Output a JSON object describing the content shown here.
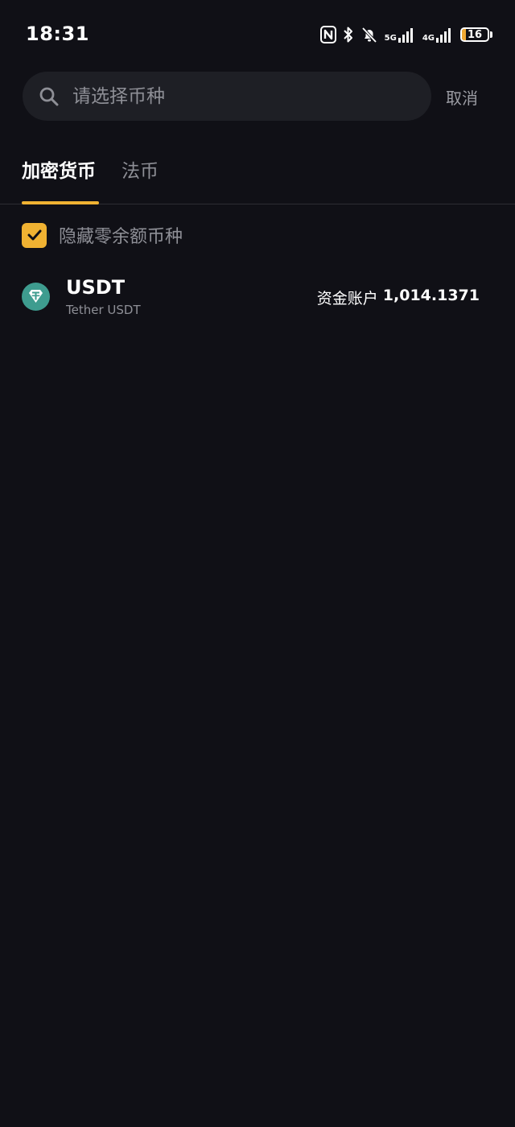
{
  "status_bar": {
    "time": "18:31",
    "network_5g": "5G",
    "network_4g": "4G",
    "battery_level": "16",
    "battery_color": "#f0a832",
    "icons": [
      "nfc-icon",
      "bluetooth-icon",
      "bell-muted-icon",
      "signal-icon",
      "battery-icon"
    ]
  },
  "search": {
    "placeholder": "请选择币种",
    "value": "",
    "cancel_label": "取消"
  },
  "tabs": [
    {
      "label": "加密货币",
      "active": true
    },
    {
      "label": "法币",
      "active": false
    }
  ],
  "filter": {
    "hide_zero_label": "隐藏零余额币种",
    "checked": true
  },
  "assets": [
    {
      "symbol": "USDT",
      "name": "Tether USDT",
      "account_label": "资金账户",
      "balance": "1,014.1371",
      "logo_color": "#3e9c8f"
    }
  ],
  "theme": {
    "background": "#101016",
    "accent": "#f0b232",
    "search_bg": "#1e1f25",
    "muted_text": "#8e8f96"
  }
}
